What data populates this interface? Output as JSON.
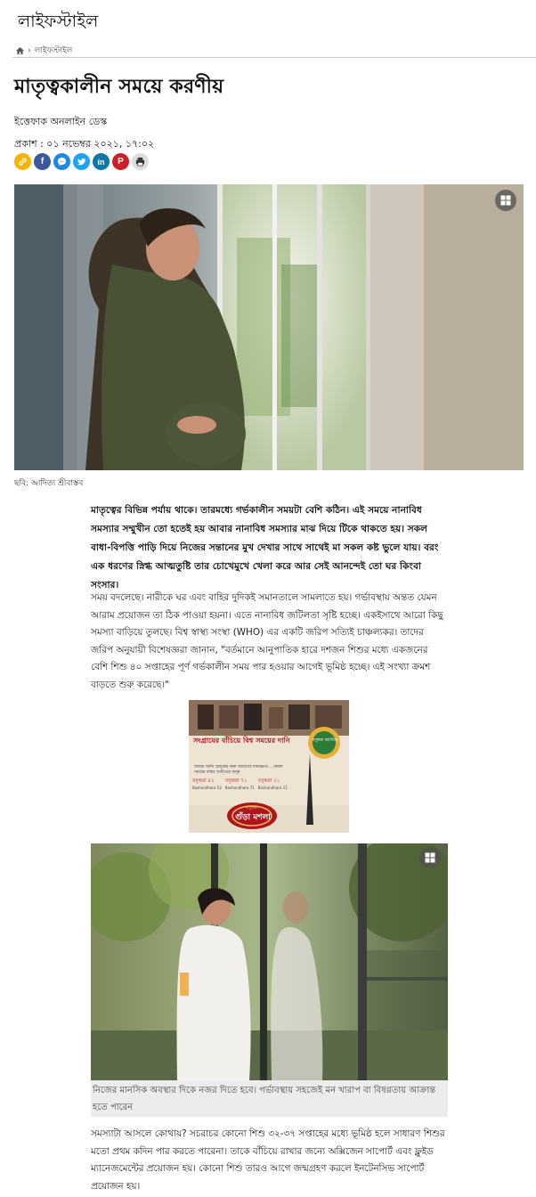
{
  "section": {
    "title": "লাইফস্টাইল"
  },
  "breadcrumb": {
    "separator": "›",
    "current": "লাইফস্টাইল",
    "home_icon": "home-icon"
  },
  "article": {
    "headline": "মাতৃত্বকালীন সময়ে করণীয়",
    "author": "ইত্তেফাক অনলাইন ডেস্ক",
    "published": "প্রকাশ : ০১ নভেম্বর ২০২১, ১৭:০২",
    "share": [
      {
        "name": "copy-link-icon",
        "color": "#f4b400"
      },
      {
        "name": "facebook-icon",
        "color": "#3b5998",
        "glyph": "f"
      },
      {
        "name": "messenger-icon",
        "color": "#1e88e5"
      },
      {
        "name": "twitter-icon",
        "color": "#1da1f2"
      },
      {
        "name": "linkedin-icon",
        "color": "#0e76a8",
        "glyph": "in"
      },
      {
        "name": "pinterest-icon",
        "color": "#cb2027",
        "glyph": "P"
      },
      {
        "name": "print-icon",
        "color": "#dddddd"
      }
    ],
    "hero_caption": "ছবি: আদিত্য শ্রীবাস্তব",
    "lead": "মাতৃত্বের বিভিন্ন পর্যায় থাকে। তারমধ্যে গর্ভকালীন সময়টা বেশি কঠিন। এই সময়ে নানাবিধ সমস্যার সম্মুখীন তো হতেই হয় আবার নানাবিধ সমস্যার মাঝ দিয়ে টিকে থাকতে হয়। সকল বাধা-বিপত্তি পাড়ি দিয়ে নিজের সন্তানের মুখ দেখার সাথে সাথেই মা সকল কষ্ট ভুলে যায়। বরং এক ধরণের স্নিগ্ধ আত্মতুষ্টি তার চোখেমুখে খেলা করে আর সেই আনন্দেই তো ঘর কিংবা সংসার।",
    "paragraph1": "সময় বদলেছে। নারীকে ঘর এবং বাহির দুদিকই সমানতালে সামলাতে হয়। গর্ভাবস্থায় অন্তত যেমন আরাম প্রয়োজন তা ঠিক পাওয়া হয়না। এতে নানাবিধ জটিলতা সৃষ্টি হচ্ছে। একইসাথে আরো কিছু সমস্যা বাড়িয়ে তুলছে। বিশ্ব স্বাস্থ্য সংস্থা (WHO) এর একটি জরিপ সত্যিই চাঞ্চল্যকর। তাদের জরিপ অনুযায়ী বিশেষজ্ঞরা জানান, \"বর্তমানে আনুপাতিক হারে দশজন শিশুর মধ্যে একজনের বেশি শিশু ৪০ সপ্তাহের পূর্ণ গর্ভকালীন সময় পার হওয়ার আগেই ভূমিষ্ঠ হচ্ছে। এই সংখ্যা ক্রমশ বাড়তে শুরু করেছে।\"",
    "photo2_caption": "নিজের মানসিক অবস্থার দিকে নজর দিতে হবে। গর্ভাবস্থায় সহজেই মন খারাপ বা বিষণ্ণতায় আক্রান্ত হতে পারেন",
    "paragraph2": "সমস্যাটা আসলে কোথায়? সচরাচর কোনো শিশু ৩২-৩৭ সপ্তাহের মধ্যে ভূমিষ্ঠ হলে সাধারণ শিশুর মতো প্রথম কদিন পার করতে পারেনা। তাকে বাঁচিয়ে রাখার জন্যে অক্সিজেন সাপোর্ট এবং ফ্লুইড ম্যানেজমেন্টের প্রয়োজন হয়। কোনো শিশু তারও আগে জন্মগ্রহণ করলে ইনটেনসিভ সাপোর্ট প্রয়োজন হয়।"
  },
  "ad": {
    "headline": "সংগ্রামের বাঁচিয়ে বিশ্ব সময়ের দানি",
    "body": "আমরা জানি গ্রাহকের জন্য আমাদের দায়বদ্ধতা... কেবল সময়ের বাস্তব অতীতের মানুষ",
    "badge": "বসুন্ধরা কর্মাধিপ্ত",
    "labels": [
      "বসুন্ধরা ৫২",
      "বসুন্ধরা ৭১",
      "বসুন্ধরা ২১"
    ],
    "sublabels": [
      "Bashundhara 52",
      "Bashundhara 71",
      "Bashundhara 21"
    ],
    "brand": "গুঁড়া মশলা",
    "brand_prefix": "বসুন্ধরা"
  },
  "icons": {
    "gallery": "gallery-icon"
  }
}
